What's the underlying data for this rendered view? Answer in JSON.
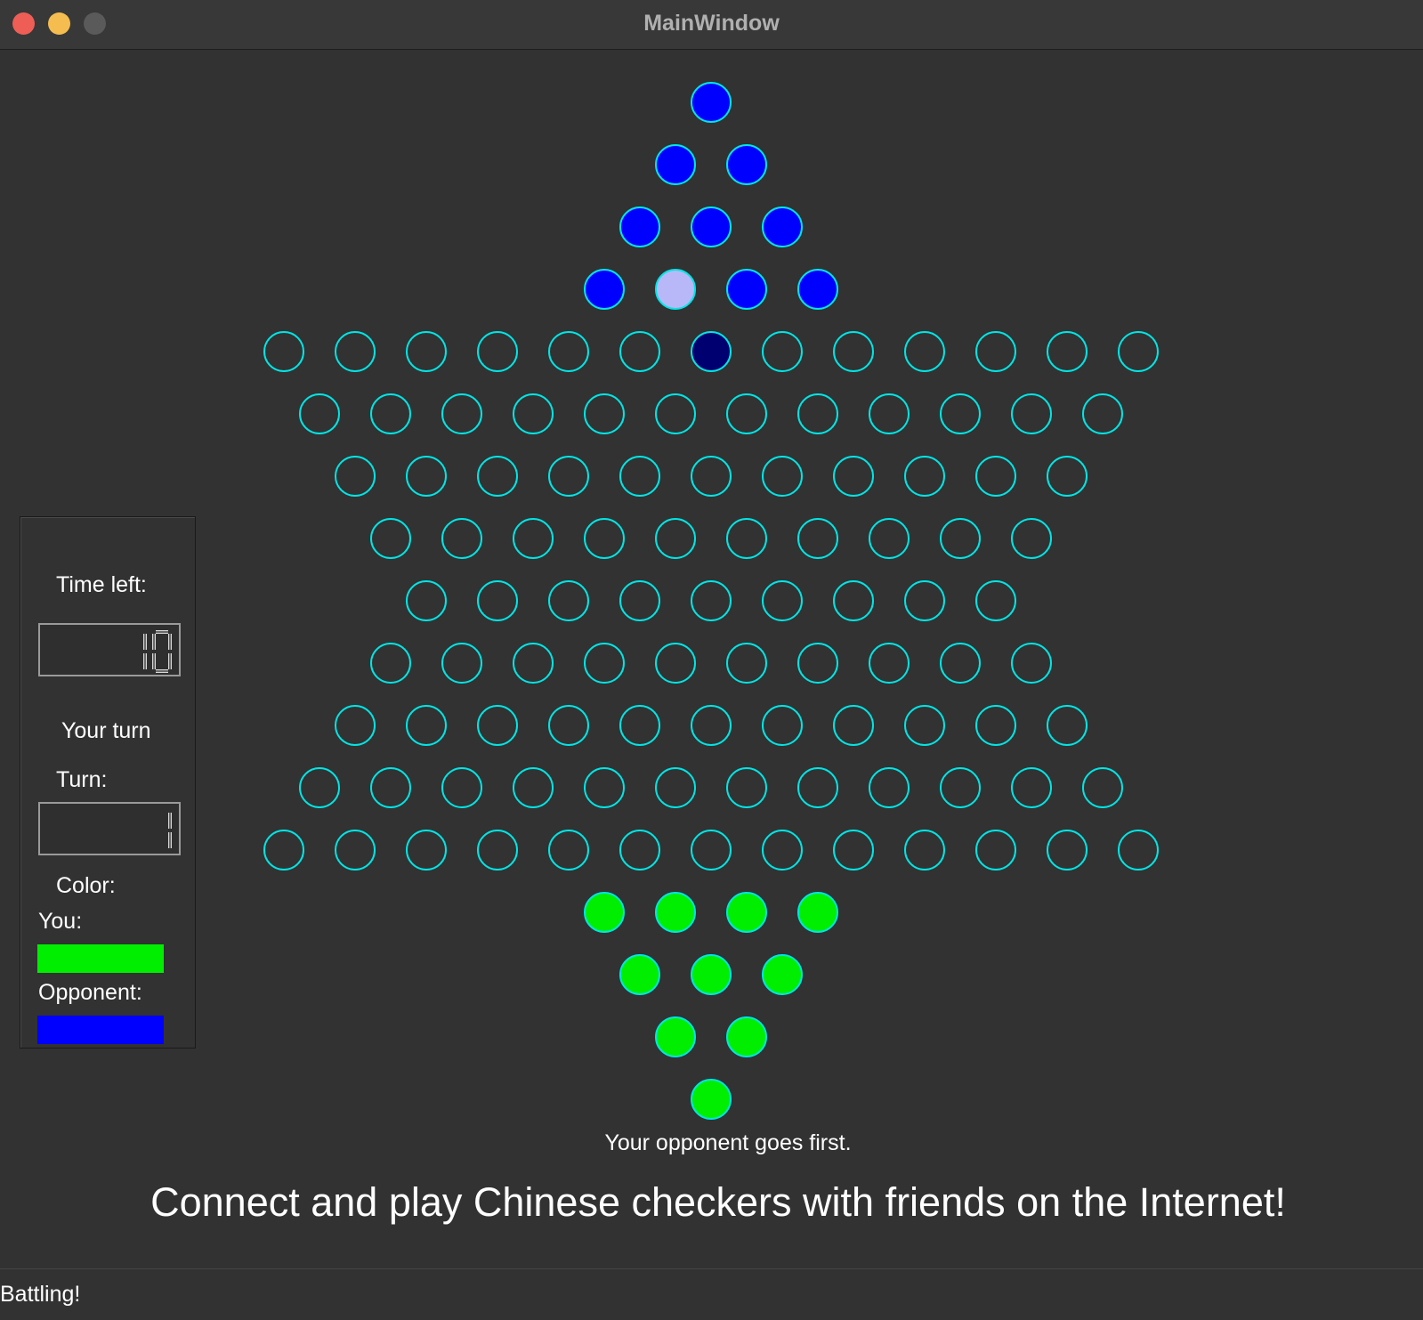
{
  "window": {
    "title": "MainWindow"
  },
  "panel": {
    "time_left_label": "Time left:",
    "time_left_value": "10",
    "turn_status": "Your turn",
    "turn_label": "Turn:",
    "turn_value": "1",
    "color_label": "Color:",
    "you_label": "You:",
    "opponent_label": "Opponent:"
  },
  "colors": {
    "you": "#00ee00",
    "opponent": "#0000ff",
    "hole_outline": "#00e5e5",
    "selected_piece": "#b8b8f8",
    "target_hole": "#000070"
  },
  "board": {
    "rows": [
      {
        "count": 1,
        "pieces": "B"
      },
      {
        "count": 2,
        "pieces": "BB"
      },
      {
        "count": 3,
        "pieces": "BBB"
      },
      {
        "count": 4,
        "pieces": "BSBB"
      },
      {
        "count": 13,
        "pieces": "......D......"
      },
      {
        "count": 12,
        "pieces": "............"
      },
      {
        "count": 11,
        "pieces": "..........."
      },
      {
        "count": 10,
        "pieces": ".........."
      },
      {
        "count": 9,
        "pieces": "........."
      },
      {
        "count": 10,
        "pieces": ".........."
      },
      {
        "count": 11,
        "pieces": "..........."
      },
      {
        "count": 12,
        "pieces": "............"
      },
      {
        "count": 13,
        "pieces": "............."
      },
      {
        "count": 4,
        "pieces": "GGGG"
      },
      {
        "count": 3,
        "pieces": "GGG"
      },
      {
        "count": 2,
        "pieces": "GG"
      },
      {
        "count": 1,
        "pieces": "G"
      }
    ],
    "legend": {
      "B": "opponent piece",
      "G": "your piece",
      "S": "selected piece",
      "D": "target hole",
      ".": "empty hole"
    }
  },
  "messages": {
    "status": "Your opponent goes first.",
    "slogan": "Connect and play Chinese checkers with friends on the Internet!"
  },
  "statusbar": {
    "text": "Battling!"
  }
}
